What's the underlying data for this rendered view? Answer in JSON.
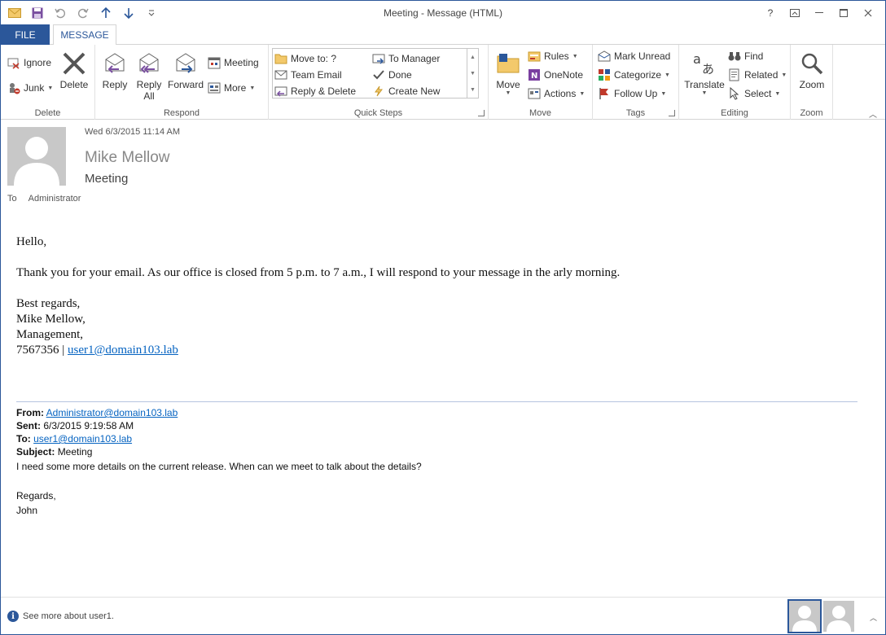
{
  "window": {
    "title": "Meeting - Message (HTML)",
    "help": "?",
    "controls": [
      "restore-ribbon",
      "minimize",
      "maximize",
      "close"
    ]
  },
  "tabs": {
    "file": "FILE",
    "message": "MESSAGE"
  },
  "ribbon": {
    "delete_group": {
      "label": "Delete",
      "ignore": "Ignore",
      "junk": "Junk",
      "delete": "Delete"
    },
    "respond_group": {
      "label": "Respond",
      "reply": "Reply",
      "reply_all_1": "Reply",
      "reply_all_2": "All",
      "forward": "Forward",
      "meeting": "Meeting",
      "more": "More"
    },
    "quick_steps": {
      "label": "Quick Steps",
      "move_to": "Move to: ?",
      "team_email": "Team Email",
      "reply_delete": "Reply & Delete",
      "to_manager": "To Manager",
      "done": "Done",
      "create_new": "Create New"
    },
    "move_group": {
      "label": "Move",
      "move": "Move",
      "rules": "Rules",
      "onenote": "OneNote",
      "actions": "Actions"
    },
    "tags_group": {
      "label": "Tags",
      "mark_unread": "Mark Unread",
      "categorize": "Categorize",
      "follow_up": "Follow Up"
    },
    "editing_group": {
      "label": "Editing",
      "translate": "Translate",
      "find": "Find",
      "related": "Related",
      "select": "Select"
    },
    "zoom_group": {
      "label": "Zoom",
      "zoom": "Zoom"
    }
  },
  "message": {
    "date": "Wed 6/3/2015 11:14 AM",
    "sender": "Mike Mellow",
    "subject": "Meeting",
    "to_label": "To",
    "to_value": "Administrator"
  },
  "body": {
    "greeting": "Hello,",
    "paragraph": "Thank you for your email. As our office is closed from 5 p.m. to 7 a.m., I will respond to your message in the arly morning.",
    "closing": "Best regards,",
    "sig_name": "Mike Mellow,",
    "sig_dept": "Management,",
    "sig_phone": "7567356 | ",
    "sig_email": "user1@domain103.lab"
  },
  "quoted": {
    "from_label": "From:",
    "from_value": "Administrator@domain103.lab",
    "sent_label": "Sent:",
    "sent_value": "6/3/2015 9:19:58 AM",
    "to_label": "To:",
    "to_value": "user1@domain103.lab",
    "subject_label": "Subject:",
    "subject_value": "Meeting",
    "line1": "I need some more details on the current release. When can we meet to talk about the details?",
    "regards": "Regards,",
    "name": "John"
  },
  "status": {
    "info_text": "See more about user1."
  },
  "colors": {
    "accent": "#2b579a",
    "link": "#0563c1"
  }
}
